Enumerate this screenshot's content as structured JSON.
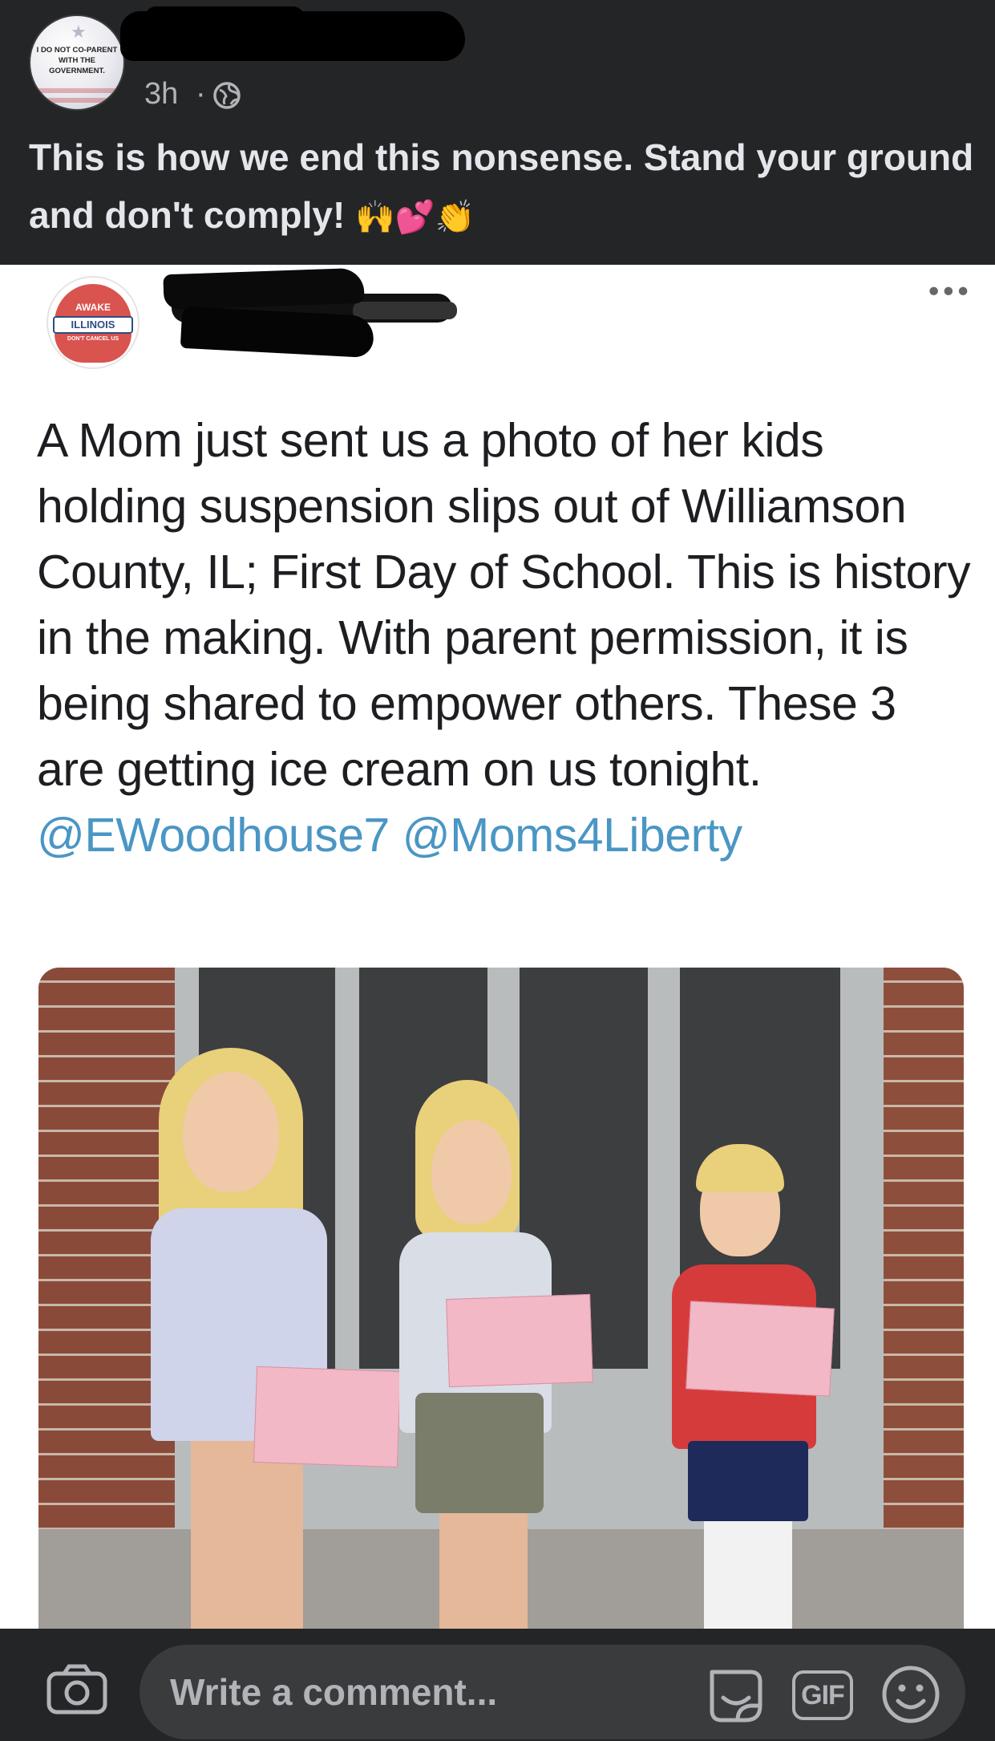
{
  "post": {
    "author_avatar_text": "I DO NOT CO-PARENT WITH THE GOVERNMENT.",
    "timestamp": "3h",
    "separator": "·",
    "privacy_icon": "globe-icon",
    "text": "This is how we end this nonsense. Stand your ground and don't comply!",
    "emojis": [
      "🙌",
      "💕",
      "👏"
    ]
  },
  "shared": {
    "logo_text_top": "AWAKE",
    "logo_text_main": "ILLINOIS",
    "logo_text_bottom": "DON'T CANCEL US",
    "more_icon": "more-horizontal-icon",
    "body_text": "A Mom just sent us a photo of her kids holding suspension slips out of Williamson County, IL; First Day of School. This is history in the making. With parent permission, it is being shared to empower others. These 3 are getting ice cream on us tonight.",
    "mentions": "@EWoodhouse7 @Moms4Liberty"
  },
  "comment_bar": {
    "placeholder": "Write a comment...",
    "gif_label": "GIF",
    "icons": [
      "camera-icon",
      "sticker-icon",
      "gif-icon",
      "emoji-icon"
    ]
  },
  "colors": {
    "dark_bg": "#242526",
    "input_bg": "#3a3b3c",
    "text_light": "#e4e6eb",
    "text_muted": "#b0b3b8",
    "mention_blue": "#4a96c4"
  }
}
